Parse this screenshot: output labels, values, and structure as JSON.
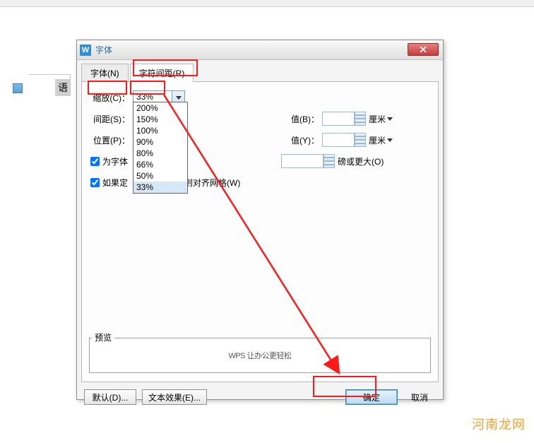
{
  "background": {
    "selected_text": "语",
    "watermark": "河南龙网"
  },
  "dialog": {
    "title": "字体",
    "tabs": {
      "font": "字体(N)",
      "spacing": "字符间距(R)"
    },
    "scale": {
      "label": "缩放(C)：",
      "value": "33%",
      "options": [
        "200%",
        "150%",
        "100%",
        "90%",
        "80%",
        "66%",
        "50%",
        "33%"
      ]
    },
    "spacing": {
      "label": "间距(S)："
    },
    "position": {
      "label": "位置(P)："
    },
    "value_b": {
      "label": "值(B)：",
      "unit": "厘米"
    },
    "value_y": {
      "label": "值(Y)：",
      "unit": "厘米"
    },
    "kerning": {
      "label": "为字体",
      "unit_text": "磅或更大(O)"
    },
    "snap": {
      "label": "如果定",
      "tail": "则对齐网格(W)"
    },
    "preview": {
      "legend": "预览",
      "sample": "WPS 让办公更轻松"
    },
    "buttons": {
      "default": "默认(D)...",
      "text_effects": "文本效果(E)...",
      "ok": "确定",
      "cancel": "取消"
    }
  }
}
